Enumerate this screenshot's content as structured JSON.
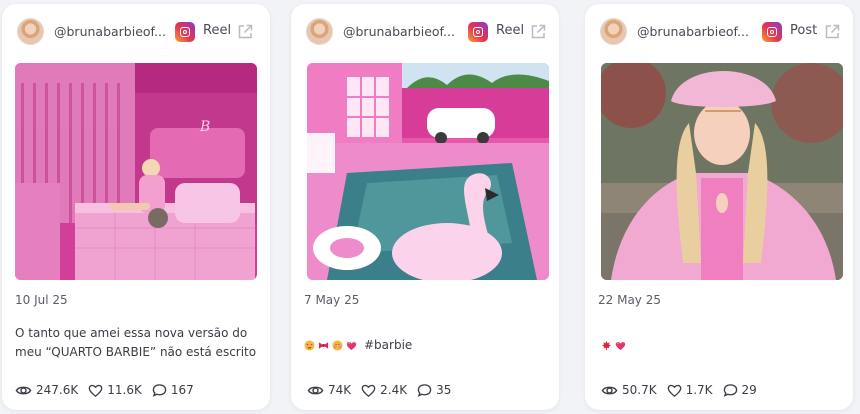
{
  "cards": [
    {
      "username": "@brunabarbieof...",
      "post_type": "Reel",
      "date": "10 Jul 25",
      "caption_lines": [
        "O tanto que amei essa nova versão do",
        "meu “QUARTO BARBIE” não está escrito...."
      ],
      "views": "247.6K",
      "likes": "11.6K",
      "comments": "167"
    },
    {
      "username": "@brunabarbieof...",
      "post_type": "Reel",
      "date": "7 May 25",
      "hashtag": "#barbie",
      "emoji_icons": [
        "heart-eyes-icon",
        "pink-bow-icon",
        "shy-face-icon",
        "sparkling-heart-icon"
      ],
      "views": "74K",
      "likes": "2.4K",
      "comments": "35"
    },
    {
      "username": "@brunabarbieof...",
      "post_type": "Post",
      "date": "22 May 25",
      "emoji_icons": [
        "maple-leaf-icon",
        "sparkling-heart-icon"
      ],
      "views": "50.7K",
      "likes": "1.7K",
      "comments": "29"
    }
  ],
  "colors": {
    "page_background": "#f2f3f7",
    "card_background": "#ffffff",
    "text_primary": "#3c3c46",
    "text_secondary": "#5d5d68",
    "icon_gray": "#b0b3bd",
    "instagram_gradient": [
      "#f9a13a",
      "#e8344e",
      "#c13584",
      "#7a3fd0"
    ]
  },
  "icons": {
    "platform": "instagram-icon",
    "open_external": "external-link-icon",
    "views": "eye-icon",
    "likes": "heart-icon",
    "comments": "comment-bubble-icon"
  }
}
